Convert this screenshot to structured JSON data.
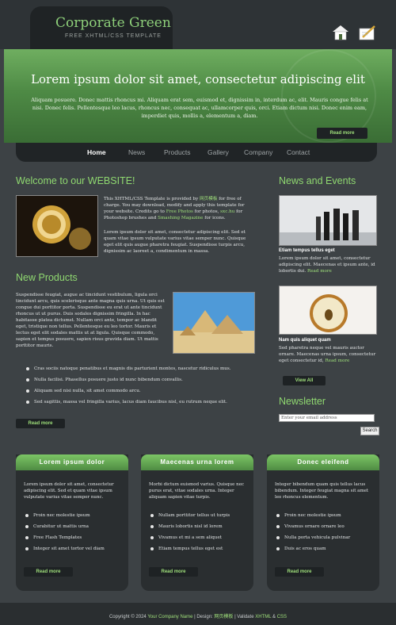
{
  "header": {
    "logo_title": "Corporate Green",
    "logo_subtitle": "FREE XHTML/CSS TEMPLATE",
    "icons": [
      "home-icon",
      "edit-icon"
    ]
  },
  "banner": {
    "title": "Lorem ipsum dolor sit amet, consectetur adipiscing elit",
    "text": "Aliquam posuere. Donec mattis rhoncus mi. Aliquam erat sem, euismod et, dignissim in, interdum ac, elit. Mauris congue felis at nisi. Donec felis. Pellentesque leo lacus, rhoncus nec, consequat ac, ullamcorper quis, orci. Etiam dictum nisi. Donec enim eam, imperdiet quis, mollis a, elementum a, diam.",
    "more_label": "Read more"
  },
  "nav": {
    "items": [
      "Home",
      "News",
      "Products",
      "Gallery",
      "Company",
      "Contact"
    ]
  },
  "welcome": {
    "heading": "Welcome to our WEBSITE!",
    "p1_a": "This XHTML/CSS Template is provided by",
    "p1_link1": "网页模板",
    "p1_b": "for free of charge. You may download, modify and apply this template for your website. Credits go to",
    "p1_link2": "Free Photos",
    "p1_c": "for photos,",
    "p1_link3": "sxc.hu",
    "p1_d": "for Photoshop brushes and",
    "p1_link4": "Smashing Magazine",
    "p1_e": "for icons.",
    "p2": "Lorem ipsum dolor sit amet, consectetur adipiscing elit. Sed et quam vitae ipsum vulputate varius vitae semper nunc. Quisque eget elit quis augue pharetra feugiat. Suspendisse turpis arcu, dignissim ac laoreet a, condimentum in massa."
  },
  "products": {
    "heading": "New Products",
    "text": "Suspendisse feugiat, augue ac tincidunt vestibulum, ligula orci tincidunt arcu, quis scelerisque ante magna quis urna. Ut quis est congue dui porttitor porta. Suspendisse eu erat ut ante tincidunt rhoncus ut ut purus. Duis sodales dignissim fringilla. In hac habitasse platea dictumst. Nullam orci ante, tempor ac blandit eget, tristique non tellus. Pellentesque eu leo tortor. Mauris et lectus eget elit sodales mattis ut at ligula. Quisque commodo, sapien et tempus posuere, sapien risus gravida diam. Ut mattis porttitor mauris.",
    "bullets": [
      "Cras sociis natoque penatibus et magnis dis parturient montes, nascetur ridiculus mus.",
      "Nulla facilisi. Phasellus posuere justo id nunc bibendum convallis.",
      "Aliquam sed nisi nulla, sit amet commodo arcu.",
      "Sed sagittis, massa vel fringilla varius, lacus diam faucibus nisl, eu rutrum neque elit."
    ],
    "more_label": "Read more"
  },
  "sidebar": {
    "news_heading": "News and Events",
    "item1_title": "Etiam tempus tellus eget",
    "item1_text": "Lorem ipsum dolor sit amet, consectetur adipiscing elit. Maecenas et ipsum ante, id lobortis dui.",
    "item1_more": "Read more",
    "item2_title": "Nam quis aliquet quam",
    "item2_text": "Sed pharetra neque vel mauris auctor ornare. Maecenas urna ipsum, consectetur eget consectetur id,",
    "item2_more": "Read more",
    "view_all": "View All",
    "newsletter_heading": "Newsletter",
    "email_placeholder": "Enter your email address",
    "search_label": "Search"
  },
  "boxes": [
    {
      "title": "Lorem ipsum dolor",
      "text": "Lorem ipsum dolor sit amet, consectetur adipiscing elit. Sed et quam vitae ipsum vulputate varius vitae semper nunc.",
      "bullets": [
        "Proin nec molestie ipsum",
        "Curabitur ut mattis urna",
        "Free Flash Templates",
        "Integer sit amet tortor vel diam"
      ],
      "more": "Read more"
    },
    {
      "title": "Maecenas urna lorem",
      "text": "Morbi dictum euismod varius. Quisque nec purus erat, vitae sodales urna. Integer aliquam sapien vitae turpis.",
      "bullets": [
        "Nullam porttitor tellus ut turpis",
        "Mauris lobortis nisl id lorem",
        "Vivamus et mi a sem aliquet",
        "Etiam tempus tellus eget est"
      ],
      "more": "Read more"
    },
    {
      "title": "Donec eleifend",
      "text": "Integer bibendum quam quis tellus lacus bibendum. Integer feugiat magna sit amet leo rhoncus elementum.",
      "bullets": [
        "Proin nec molestie ipsum",
        "Vivamus ornare ornare leo",
        "Nulla porta vehicula pulvinar",
        "Duis ac eros quam"
      ],
      "more": "Read more"
    }
  ],
  "footer": {
    "prefix": "Copyright © 2024",
    "company": "Your Company Name",
    "mid": "| Design:",
    "design": "网页模板",
    "sep": "| Validate",
    "xhtml": "XHTML",
    "amp": "&",
    "css": "CSS"
  }
}
